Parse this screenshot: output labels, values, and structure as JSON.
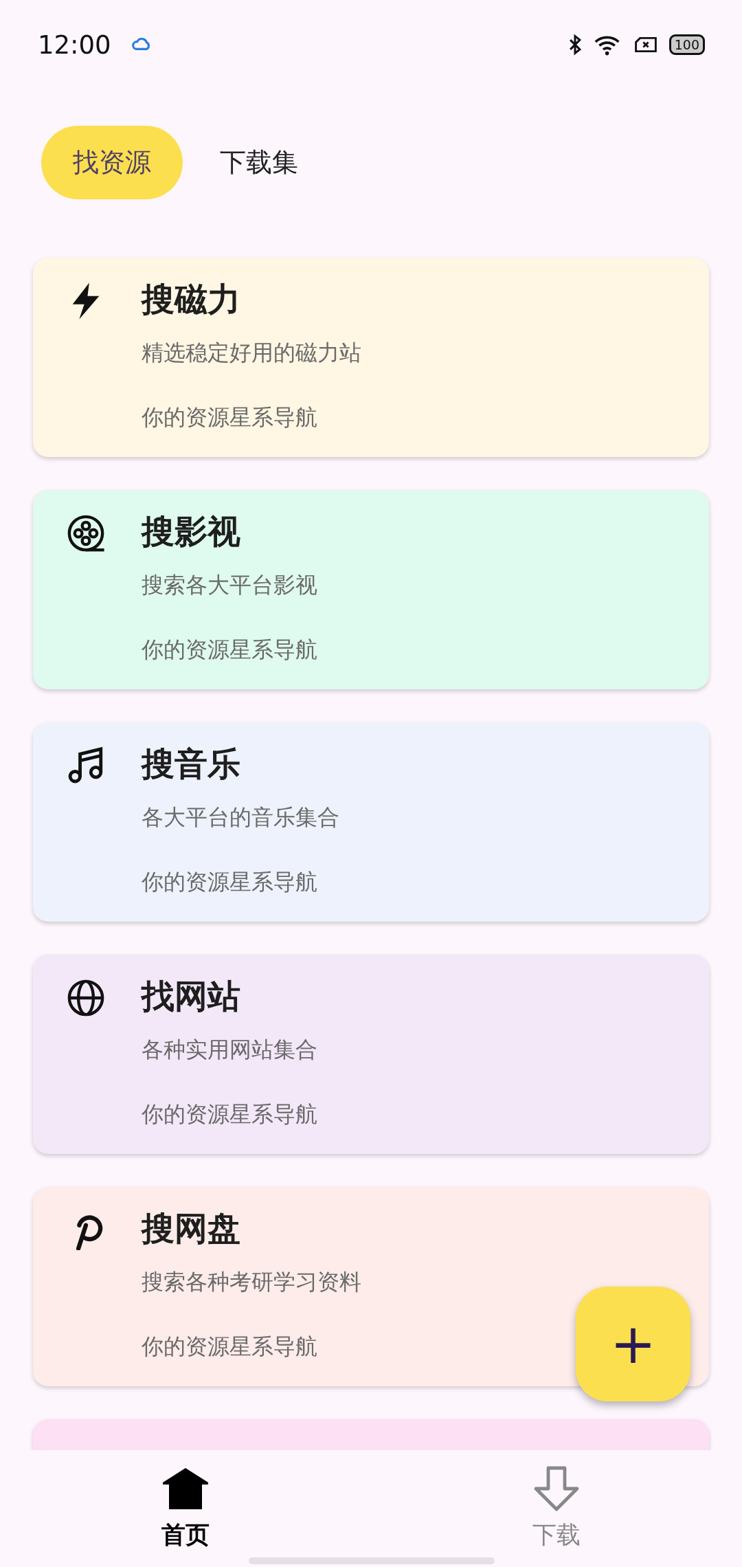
{
  "status_bar": {
    "time": "12:00",
    "battery": "100"
  },
  "tabs": [
    {
      "label": "找资源",
      "selected": true
    },
    {
      "label": "下载集",
      "selected": false
    }
  ],
  "cards": [
    {
      "kind": "bolt",
      "title": "搜磁力",
      "subtitle": "精选稳定好用的磁力站",
      "footer": "你的资源星系导航",
      "color": "#fff6e3"
    },
    {
      "kind": "film",
      "title": "搜影视",
      "subtitle": "搜索各大平台影视",
      "footer": "你的资源星系导航",
      "color": "#dffaee"
    },
    {
      "kind": "music",
      "title": "搜音乐",
      "subtitle": "各大平台的音乐集合",
      "footer": "你的资源星系导航",
      "color": "#eef2fd"
    },
    {
      "kind": "globe",
      "title": "找网站",
      "subtitle": "各种实用网站集合",
      "footer": "你的资源星系导航",
      "color": "#f3e8f8"
    },
    {
      "kind": "p",
      "title": "搜网盘",
      "subtitle": "搜索各种考研学习资料",
      "footer": "你的资源星系导航",
      "color": "#fdece9"
    },
    {
      "color": "#fde0f3"
    }
  ],
  "fab": {
    "label": "+"
  },
  "bottom_nav": [
    {
      "kind": "home",
      "label": "首页",
      "selected": true
    },
    {
      "kind": "download",
      "label": "下载",
      "selected": false
    }
  ]
}
